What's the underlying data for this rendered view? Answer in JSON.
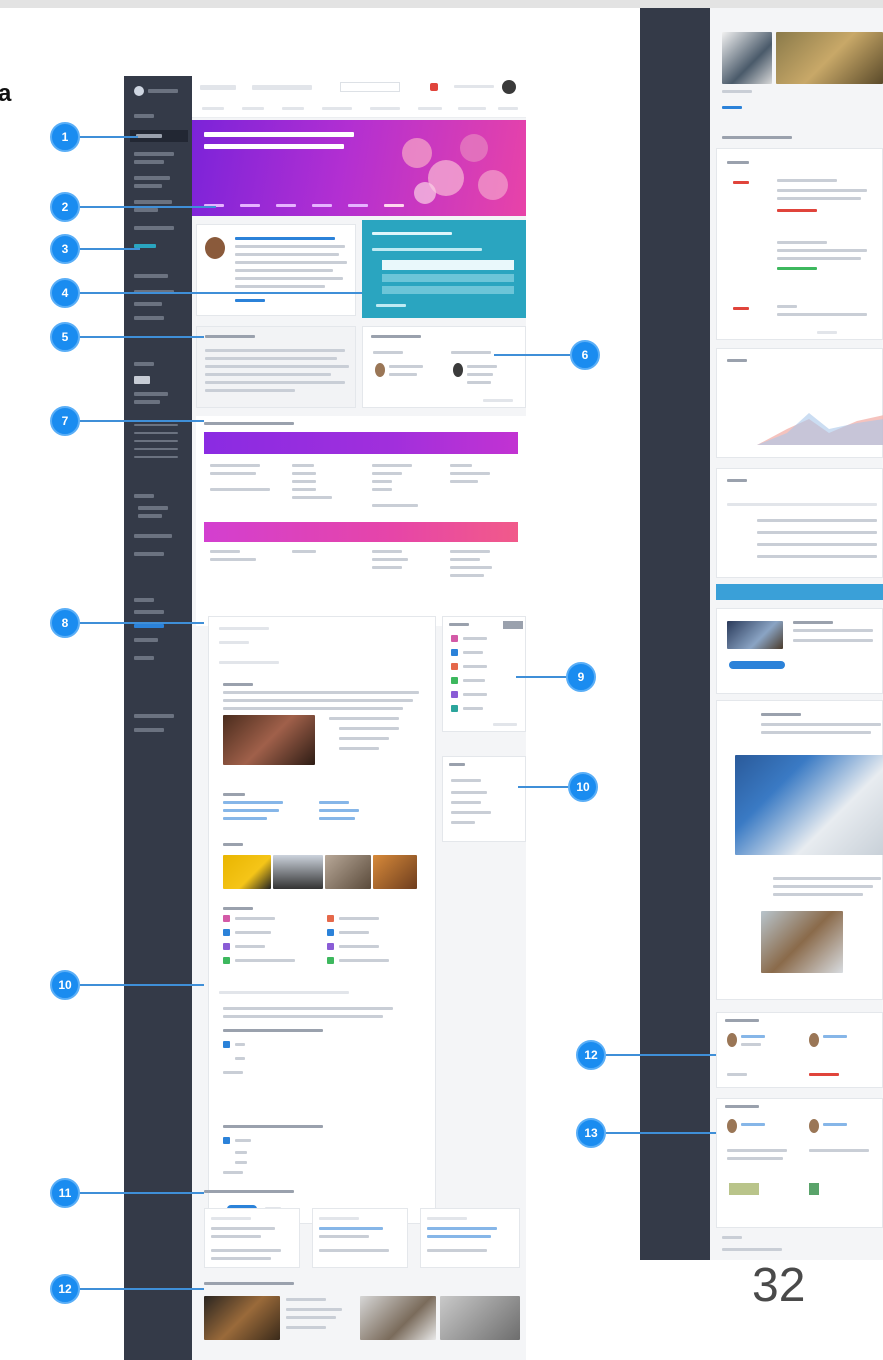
{
  "slide": {
    "title_fragment": "a",
    "page_number": "32"
  },
  "callouts": {
    "left": [
      "1",
      "2",
      "3",
      "4",
      "5",
      "6",
      "7",
      "8",
      "9",
      "10",
      "10",
      "11",
      "12"
    ],
    "right": [
      "12",
      "13"
    ]
  },
  "colors": {
    "sidebar": "#343a48",
    "badge": "#1a8cf0",
    "hero_purple": "#8a2be2",
    "hero_pink": "#e040a0",
    "teal_panel": "#2aa5c0",
    "accent_blue": "#2b82d9"
  }
}
